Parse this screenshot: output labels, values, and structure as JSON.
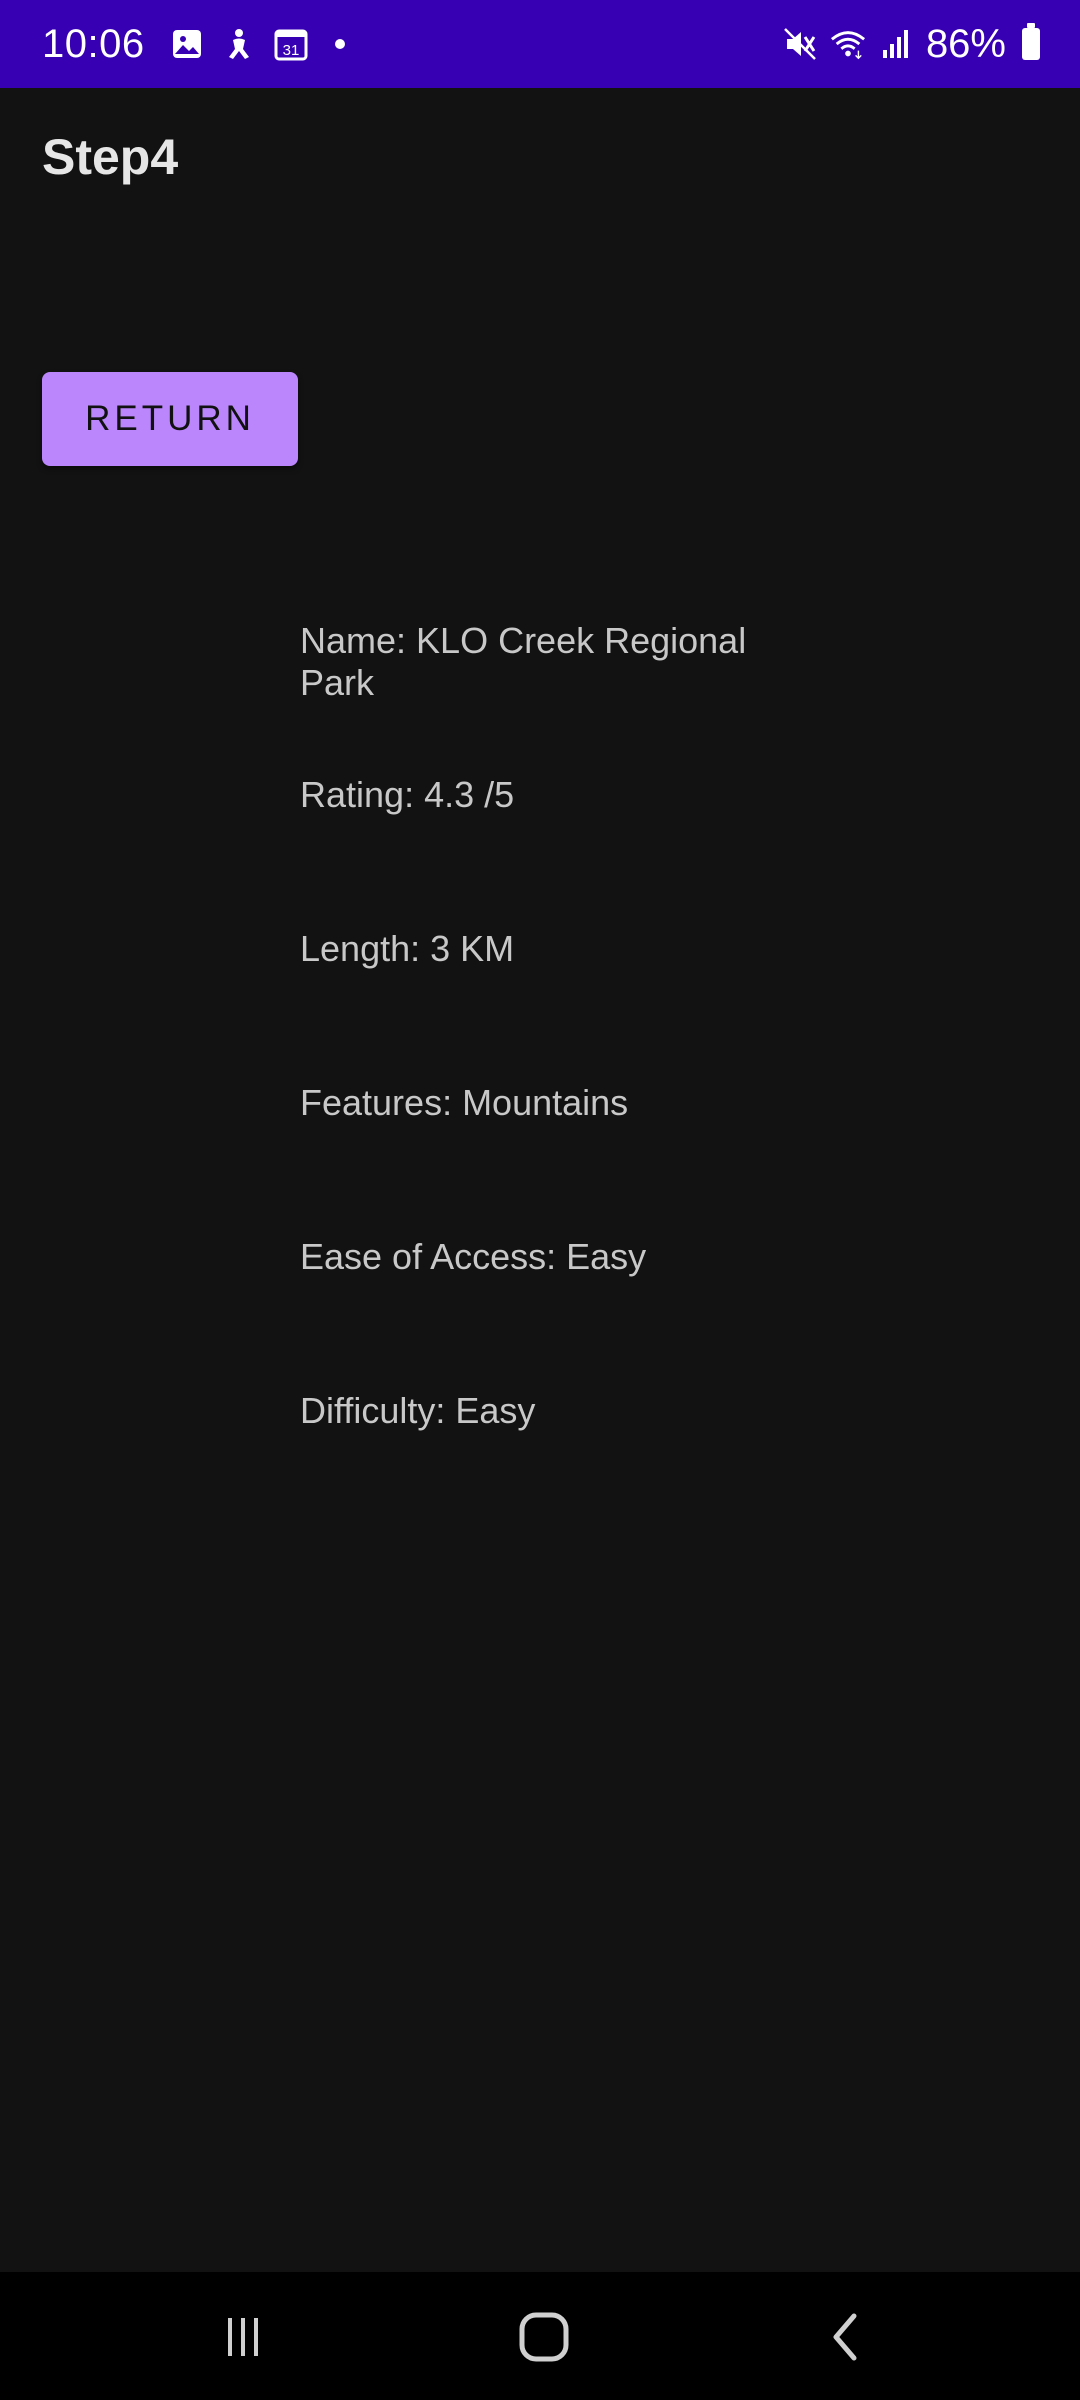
{
  "status_bar": {
    "time": "10:06",
    "battery": "86%",
    "icons_left": [
      "gallery-icon",
      "accessibility-icon",
      "calendar-icon",
      "notification-dot-icon"
    ],
    "icons_right": [
      "mute-icon",
      "wifi-icon",
      "signal-icon",
      "battery-icon"
    ],
    "calendar_day": "31"
  },
  "app_bar": {
    "title": "Step4"
  },
  "actions": {
    "return_label": "RETURN"
  },
  "details": {
    "name": "Name: KLO Creek Regional Park",
    "rating": "Rating: 4.3 /5",
    "length": "Length: 3 KM",
    "features": "Features: Mountains",
    "access": "Ease of Access: Easy",
    "difficulty": "Difficulty: Easy"
  },
  "nav_bar": {
    "icons": [
      "recent-apps-icon",
      "home-icon",
      "back-icon"
    ]
  },
  "colors": {
    "status_bar": "#3700b3",
    "background": "#121212",
    "button": "#bb86fc",
    "text": "#c8c8c8"
  }
}
